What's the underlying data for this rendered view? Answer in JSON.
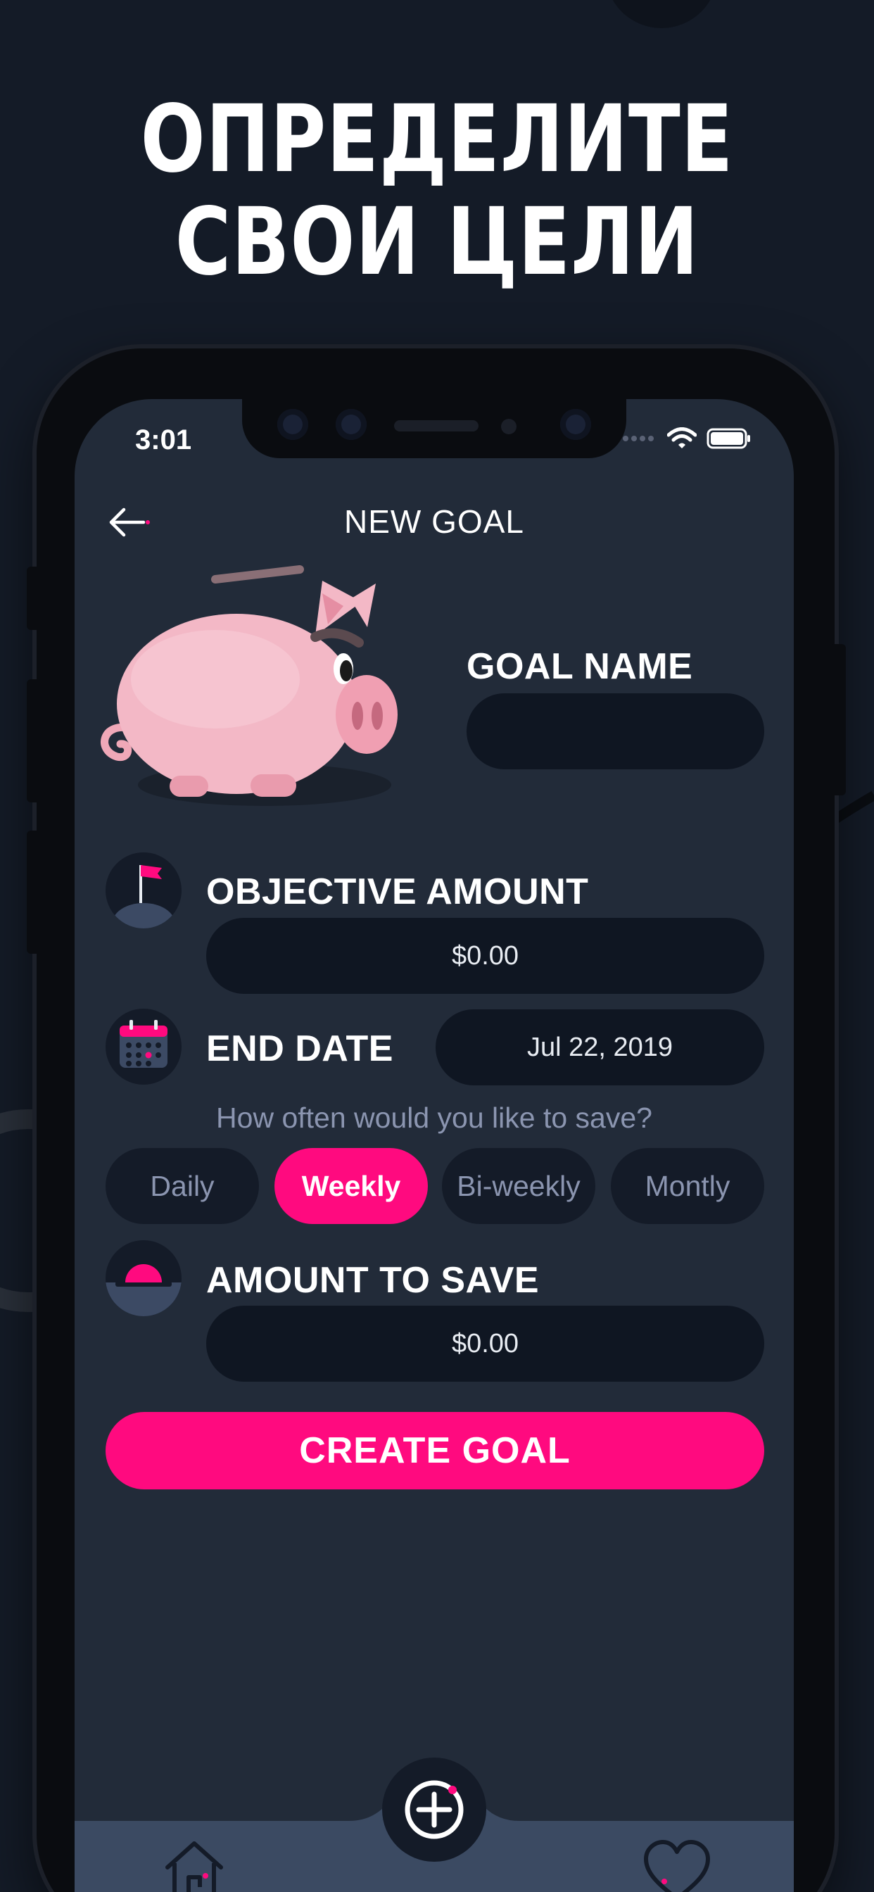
{
  "headline": {
    "line1": "ОПРЕДЕЛИТЕ",
    "line2": "СВОИ ЦЕЛИ"
  },
  "status_bar": {
    "time": "3:01"
  },
  "header": {
    "title": "NEW GOAL"
  },
  "goal_name": {
    "label": "GOAL NAME",
    "value": ""
  },
  "objective_amount": {
    "label": "OBJECTIVE AMOUNT",
    "value": "$0.00"
  },
  "end_date": {
    "label": "END DATE",
    "value": "Jul 22, 2019"
  },
  "frequency": {
    "question": "How often would you like to save?",
    "options": [
      "Daily",
      "Weekly",
      "Bi-weekly",
      "Montly"
    ],
    "selected": "Weekly"
  },
  "amount_to_save": {
    "label": "AMOUNT TO SAVE",
    "value": "$0.00"
  },
  "create_button": {
    "label": "CREATE GOAL"
  },
  "tabbar": {
    "icons": [
      "home-icon",
      "add-icon",
      "heart-icon"
    ]
  },
  "colors": {
    "accent": "#ff0a7f",
    "background": "#141b27",
    "screen": "#222b39",
    "field": "#0f1622",
    "muted_text": "#8b95b0"
  }
}
